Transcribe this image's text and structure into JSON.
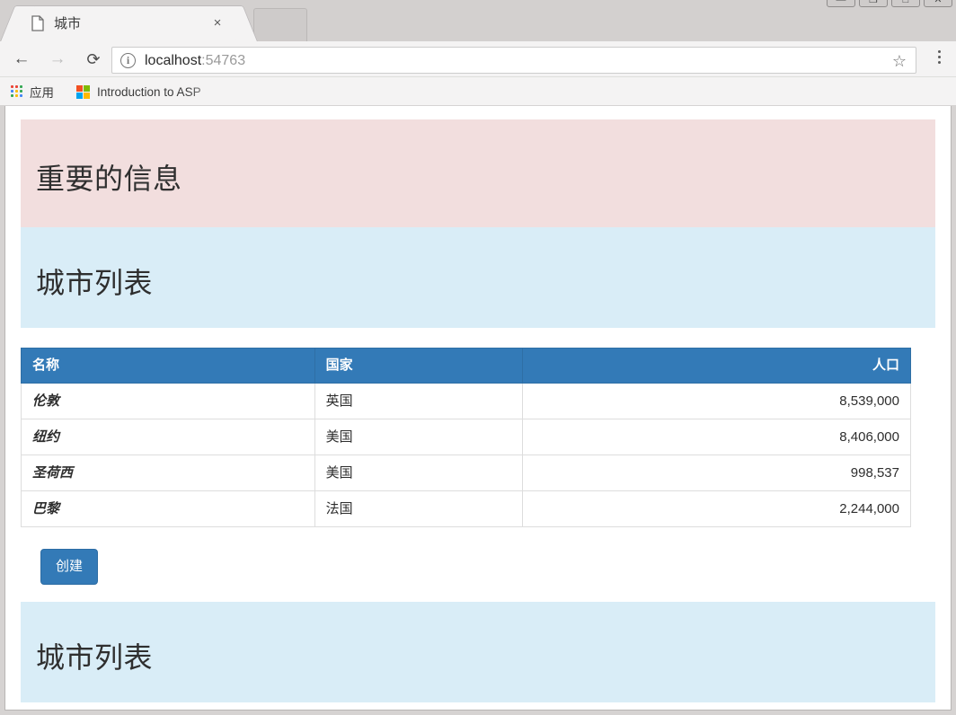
{
  "browser": {
    "tab": {
      "title": "城市",
      "favicon": "page-icon",
      "close_label": "×"
    },
    "window_controls": [
      {
        "name": "minimize",
        "glyph": "—"
      },
      {
        "name": "restore",
        "glyph": "❐"
      },
      {
        "name": "maximize",
        "glyph": "□"
      },
      {
        "name": "close",
        "glyph": "✕"
      }
    ],
    "nav": {
      "back": "←",
      "forward": "→",
      "reload": "⟳"
    },
    "omnibox": {
      "info_glyph": "i",
      "host": "localhost",
      "port": ":54763",
      "star": "☆"
    },
    "bookmarks": [
      {
        "label": "应用",
        "icon": "apps-grid-icon"
      },
      {
        "label": "Introduction to ASP",
        "icon": "microsoft-logo-icon"
      }
    ]
  },
  "page": {
    "alert_danger": {
      "heading": "重要的信息"
    },
    "alert_info_top": {
      "heading": "城市列表"
    },
    "alert_info_bottom": {
      "heading": "城市列表"
    },
    "table": {
      "columns": [
        "名称",
        "国家",
        "人口"
      ],
      "rows": [
        {
          "name": "伦敦",
          "country": "英国",
          "population": "8,539,000"
        },
        {
          "name": "纽约",
          "country": "美国",
          "population": "8,406,000"
        },
        {
          "name": "圣荷西",
          "country": "美国",
          "population": "998,537"
        },
        {
          "name": "巴黎",
          "country": "法国",
          "population": "2,244,000"
        }
      ]
    },
    "create_button": {
      "label": "创建"
    }
  },
  "colors": {
    "alert_danger_bg": "#f2dede",
    "alert_info_bg": "#d9edf7",
    "table_header_bg": "#337ab7",
    "button_bg": "#337ab7",
    "tab_active_bg": "#f4f3f3",
    "chrome_bg": "#d3d0cf"
  }
}
